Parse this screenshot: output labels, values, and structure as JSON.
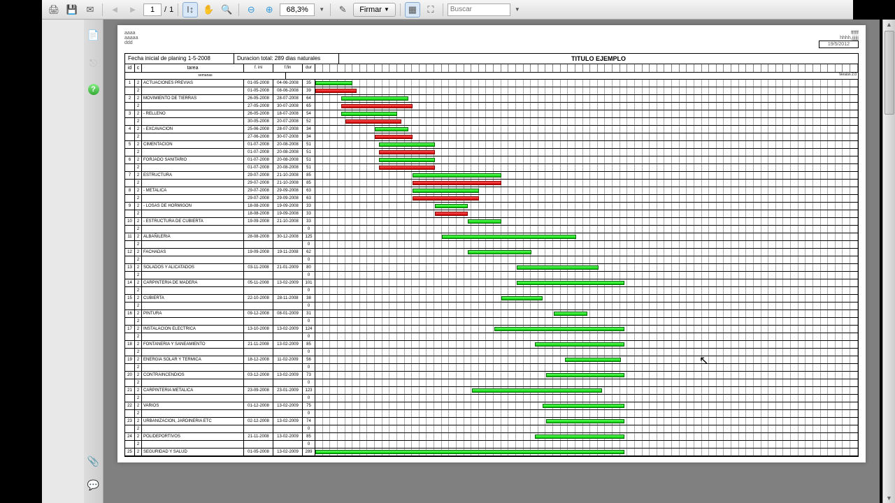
{
  "toolbar": {
    "page_current": "1",
    "page_sep": "/",
    "page_total": "1",
    "zoom": "68,3%",
    "sign_label": "Firmar",
    "search_placeholder": "Buscar"
  },
  "doc_header": {
    "left1": "aaaa",
    "left2": "aaaaa",
    "left3": "ddd",
    "right1": "ffffff",
    "right2": "hhhh,jjjjjj",
    "date_stamp": "19/5/2012"
  },
  "title_row": {
    "cell1": "Fecha inicial de planing 1-5-2008",
    "cell2": "Duracion total: 289 dias naturales",
    "main": "TITULO EJEMPLO"
  },
  "columns": {
    "id": "id",
    "c": "c",
    "task": "tarea",
    "start": "f. ini",
    "end": "f.fin",
    "dur": "dur",
    "weeks_label": "semanas",
    "version": "Version 2.0"
  },
  "weeks_count": 73,
  "chart_data": {
    "type": "gantt",
    "x_unit": "weeks",
    "x_range": [
      0,
      73
    ],
    "planning_start": "01-05-2008",
    "total_duration_days": 289,
    "tasks": [
      {
        "id": "1",
        "c": "2",
        "name": "ACTUACIONES PREVIAS",
        "rows": [
          {
            "start": "01-05-2008",
            "end": "04-06-2008",
            "dur": "35",
            "bar": {
              "color": "green",
              "from": 0,
              "to": 5
            }
          },
          {
            "start": "01-05-2008",
            "end": "08-06-2008",
            "dur": "39",
            "bar": {
              "color": "red",
              "from": 0,
              "to": 5.5
            }
          }
        ]
      },
      {
        "id": "2",
        "c": "2",
        "name": "MOVIMIENTO DE TIERRAS",
        "rows": [
          {
            "start": "26-05-2008",
            "end": "28-07-2008",
            "dur": "64",
            "bar": {
              "color": "green",
              "from": 3.5,
              "to": 12.5
            }
          },
          {
            "start": "27-05-2008",
            "end": "30-07-2008",
            "dur": "65",
            "bar": {
              "color": "red",
              "from": 3.5,
              "to": 13
            }
          }
        ]
      },
      {
        "id": "3",
        "c": "2",
        "name": "- RELLENO",
        "rows": [
          {
            "start": "26-05-2008",
            "end": "18-07-2008",
            "dur": "54",
            "bar": {
              "color": "green",
              "from": 3.5,
              "to": 11
            }
          },
          {
            "start": "30-05-2008",
            "end": "20-07-2008",
            "dur": "52",
            "bar": {
              "color": "red",
              "from": 4,
              "to": 11.5
            }
          }
        ]
      },
      {
        "id": "4",
        "c": "2",
        "name": "- EXCAVACION",
        "rows": [
          {
            "start": "25-06-2008",
            "end": "28-07-2008",
            "dur": "34",
            "bar": {
              "color": "green",
              "from": 8,
              "to": 12.5
            }
          },
          {
            "start": "27-06-2008",
            "end": "30-07-2008",
            "dur": "34",
            "bar": {
              "color": "red",
              "from": 8,
              "to": 13
            }
          }
        ]
      },
      {
        "id": "5",
        "c": "2",
        "name": "CIMENTACION",
        "rows": [
          {
            "start": "01-07-2008",
            "end": "20-08-2008",
            "dur": "51",
            "bar": {
              "color": "green",
              "from": 8.5,
              "to": 16
            }
          },
          {
            "start": "01-07-2008",
            "end": "20-08-2008",
            "dur": "51",
            "bar": {
              "color": "red",
              "from": 8.5,
              "to": 16
            }
          }
        ]
      },
      {
        "id": "6",
        "c": "2",
        "name": "FORJADO SANITARIO",
        "rows": [
          {
            "start": "01-07-2008",
            "end": "20-08-2008",
            "dur": "51",
            "bar": {
              "color": "green",
              "from": 8.5,
              "to": 16
            }
          },
          {
            "start": "01-07-2008",
            "end": "20-08-2008",
            "dur": "51",
            "bar": {
              "color": "red",
              "from": 8.5,
              "to": 16
            }
          }
        ]
      },
      {
        "id": "7",
        "c": "2",
        "name": "ESTRUCTURA",
        "rows": [
          {
            "start": "29-07-2008",
            "end": "21-10-2008",
            "dur": "85",
            "bar": {
              "color": "green",
              "from": 13,
              "to": 25
            }
          },
          {
            "start": "29-07-2008",
            "end": "21-10-2008",
            "dur": "85",
            "bar": {
              "color": "red",
              "from": 13,
              "to": 25
            }
          }
        ]
      },
      {
        "id": "8",
        "c": "2",
        "name": "- METALICA",
        "rows": [
          {
            "start": "29-07-2008",
            "end": "29-09-2008",
            "dur": "63",
            "bar": {
              "color": "green",
              "from": 13,
              "to": 22
            }
          },
          {
            "start": "29-07-2008",
            "end": "29-09-2008",
            "dur": "63",
            "bar": {
              "color": "red",
              "from": 13,
              "to": 22
            }
          }
        ]
      },
      {
        "id": "9",
        "c": "2",
        "name": "- LOSAS DE HORMIGON",
        "rows": [
          {
            "start": "18-08-2008",
            "end": "19-09-2008",
            "dur": "33",
            "bar": {
              "color": "green",
              "from": 16,
              "to": 20.5
            }
          },
          {
            "start": "18-08-2008",
            "end": "19-09-2008",
            "dur": "33",
            "bar": {
              "color": "red",
              "from": 16,
              "to": 20.5
            }
          }
        ]
      },
      {
        "id": "10",
        "c": "2",
        "name": "- ESTRUCTURA DE CUBIERTA",
        "rows": [
          {
            "start": "19-09-2008",
            "end": "21-10-2008",
            "dur": "33",
            "bar": {
              "color": "green",
              "from": 20.5,
              "to": 25
            }
          },
          {
            "start": "",
            "end": "",
            "dur": "0",
            "bar": null
          }
        ]
      },
      {
        "id": "11",
        "c": "2",
        "name": "ALBAÑILERIA",
        "rows": [
          {
            "start": "28-08-2008",
            "end": "30-12-2008",
            "dur": "125",
            "bar": {
              "color": "green",
              "from": 17,
              "to": 35
            }
          },
          {
            "start": "",
            "end": "",
            "dur": "0",
            "bar": null
          }
        ]
      },
      {
        "id": "12",
        "c": "2",
        "name": "FACHADAS",
        "rows": [
          {
            "start": "19-09-2008",
            "end": "19-11-2008",
            "dur": "62",
            "bar": {
              "color": "green",
              "from": 20.5,
              "to": 29
            }
          },
          {
            "start": "",
            "end": "",
            "dur": "0",
            "bar": null
          }
        ]
      },
      {
        "id": "13",
        "c": "2",
        "name": "SOLADOS Y ALICATADOS",
        "rows": [
          {
            "start": "03-11-2008",
            "end": "21-01-2009",
            "dur": "80",
            "bar": {
              "color": "green",
              "from": 27,
              "to": 38
            }
          },
          {
            "start": "",
            "end": "",
            "dur": "0",
            "bar": null
          }
        ]
      },
      {
        "id": "14",
        "c": "2",
        "name": "CARPINTERIA DE MADERA",
        "rows": [
          {
            "start": "05-11-2008",
            "end": "13-02-2009",
            "dur": "101",
            "bar": {
              "color": "green",
              "from": 27,
              "to": 41.5
            }
          },
          {
            "start": "",
            "end": "",
            "dur": "0",
            "bar": null
          }
        ]
      },
      {
        "id": "15",
        "c": "2",
        "name": "CUBIERTA",
        "rows": [
          {
            "start": "22-10-2008",
            "end": "28-11-2008",
            "dur": "38",
            "bar": {
              "color": "green",
              "from": 25,
              "to": 30.5
            }
          },
          {
            "start": "",
            "end": "",
            "dur": "0",
            "bar": null
          }
        ]
      },
      {
        "id": "16",
        "c": "2",
        "name": "PINTURA",
        "rows": [
          {
            "start": "09-12-2008",
            "end": "08-01-2009",
            "dur": "31",
            "bar": {
              "color": "green",
              "from": 32,
              "to": 36.5
            }
          },
          {
            "start": "",
            "end": "",
            "dur": "0",
            "bar": null
          }
        ]
      },
      {
        "id": "17",
        "c": "2",
        "name": "INSTALACION ELECTRICA",
        "rows": [
          {
            "start": "13-10-2008",
            "end": "13-02-2009",
            "dur": "124",
            "bar": {
              "color": "green",
              "from": 24,
              "to": 41.5
            }
          },
          {
            "start": "",
            "end": "",
            "dur": "0",
            "bar": null
          }
        ]
      },
      {
        "id": "18",
        "c": "2",
        "name": "FONTANERIA Y SANEAMIENTO",
        "rows": [
          {
            "start": "21-11-2008",
            "end": "13-02-2009",
            "dur": "85",
            "bar": {
              "color": "green",
              "from": 29.5,
              "to": 41.5
            }
          },
          {
            "start": "",
            "end": "",
            "dur": "0",
            "bar": null
          }
        ]
      },
      {
        "id": "19",
        "c": "2",
        "name": "ENERGIA SOLAR Y TERMICA",
        "rows": [
          {
            "start": "18-12-2008",
            "end": "11-02-2009",
            "dur": "56",
            "bar": {
              "color": "green",
              "from": 33.5,
              "to": 41
            }
          },
          {
            "start": "",
            "end": "",
            "dur": "0",
            "bar": null
          }
        ]
      },
      {
        "id": "20",
        "c": "2",
        "name": "CONTRAINCENDIOS",
        "rows": [
          {
            "start": "03-12-2008",
            "end": "13-02-2009",
            "dur": "73",
            "bar": {
              "color": "green",
              "from": 31,
              "to": 41.5
            }
          },
          {
            "start": "",
            "end": "",
            "dur": "0",
            "bar": null
          }
        ]
      },
      {
        "id": "21",
        "c": "2",
        "name": "CARPINTERIA METALICA",
        "rows": [
          {
            "start": "23-09-2008",
            "end": "23-01-2009",
            "dur": "123",
            "bar": {
              "color": "green",
              "from": 21,
              "to": 38.5
            }
          },
          {
            "start": "",
            "end": "",
            "dur": "0",
            "bar": null
          }
        ]
      },
      {
        "id": "22",
        "c": "2",
        "name": "VARIOS",
        "rows": [
          {
            "start": "01-12-2008",
            "end": "13-02-2009",
            "dur": "75",
            "bar": {
              "color": "green",
              "from": 30.5,
              "to": 41.5
            }
          },
          {
            "start": "",
            "end": "",
            "dur": "0",
            "bar": null
          }
        ]
      },
      {
        "id": "23",
        "c": "2",
        "name": "URBANIZACION, JARDINERIA ETC",
        "rows": [
          {
            "start": "02-12-2008",
            "end": "13-02-2009",
            "dur": "74",
            "bar": {
              "color": "green",
              "from": 31,
              "to": 41.5
            }
          },
          {
            "start": "",
            "end": "",
            "dur": "0",
            "bar": null
          }
        ]
      },
      {
        "id": "24",
        "c": "2",
        "name": "POLIDEPORTIVOS",
        "rows": [
          {
            "start": "21-11-2008",
            "end": "13-02-2009",
            "dur": "85",
            "bar": {
              "color": "green",
              "from": 29.5,
              "to": 41.5
            }
          },
          {
            "start": "",
            "end": "",
            "dur": "0",
            "bar": null
          }
        ]
      },
      {
        "id": "25",
        "c": "2",
        "name": "SEGURIDAD Y SALUD",
        "rows": [
          {
            "start": "01-05-2008",
            "end": "13-02-2009",
            "dur": "289",
            "bar": {
              "color": "green",
              "from": 0,
              "to": 41.5
            }
          }
        ]
      }
    ]
  }
}
